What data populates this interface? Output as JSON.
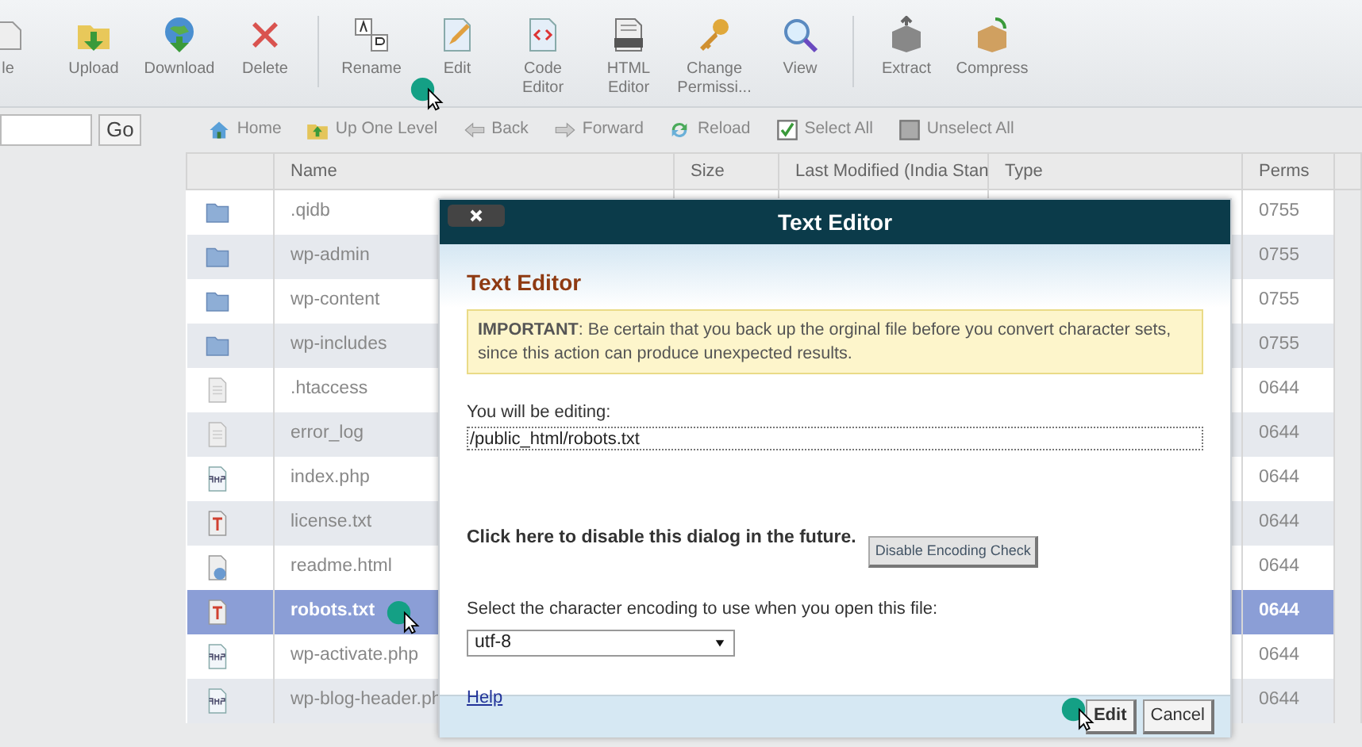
{
  "toolbar": [
    {
      "label": "le",
      "kind": "file"
    },
    {
      "label": "Upload",
      "kind": "upload"
    },
    {
      "label": "Download",
      "kind": "download"
    },
    {
      "label": "Delete",
      "kind": "delete"
    },
    {
      "kind": "separator"
    },
    {
      "label": "Rename",
      "kind": "rename"
    },
    {
      "label": "Edit",
      "kind": "edit"
    },
    {
      "label": "Code Editor",
      "kind": "code"
    },
    {
      "label": "HTML Editor",
      "kind": "html"
    },
    {
      "label": "Change Permissi...",
      "kind": "key"
    },
    {
      "label": "View",
      "kind": "view"
    },
    {
      "kind": "separator"
    },
    {
      "label": "Extract",
      "kind": "extract"
    },
    {
      "label": "Compress",
      "kind": "compress"
    }
  ],
  "search": {
    "button": "Go"
  },
  "nav": [
    {
      "label": "Home",
      "kind": "home"
    },
    {
      "label": "Up One Level",
      "kind": "up"
    },
    {
      "label": "Back",
      "kind": "back"
    },
    {
      "label": "Forward",
      "kind": "forward"
    },
    {
      "label": "Reload",
      "kind": "reload"
    },
    {
      "label": "Select All",
      "kind": "select"
    },
    {
      "label": "Unselect All",
      "kind": "unselect"
    }
  ],
  "table": {
    "columns": [
      "Name",
      "Size",
      "Last Modified (India Stan",
      "Type",
      "Perms"
    ],
    "rows": [
      {
        "name": ".qidb",
        "kind": "folder",
        "perms": "0755",
        "selected": false
      },
      {
        "name": "wp-admin",
        "kind": "folder",
        "perms": "0755",
        "selected": false
      },
      {
        "name": "wp-content",
        "kind": "folder",
        "perms": "0755",
        "selected": false
      },
      {
        "name": "wp-includes",
        "kind": "folder",
        "perms": "0755",
        "selected": false
      },
      {
        "name": ".htaccess",
        "kind": "doc",
        "perms": "0644",
        "selected": false
      },
      {
        "name": "error_log",
        "kind": "doc",
        "perms": "0644",
        "selected": false
      },
      {
        "name": "index.php",
        "kind": "php",
        "perms": "0644",
        "selected": false
      },
      {
        "name": "license.txt",
        "kind": "txt",
        "perms": "0644",
        "selected": false
      },
      {
        "name": "readme.html",
        "kind": "html",
        "perms": "0644",
        "selected": false
      },
      {
        "name": "robots.txt",
        "kind": "txt",
        "perms": "0644",
        "selected": true
      },
      {
        "name": "wp-activate.php",
        "kind": "php",
        "perms": "0644",
        "selected": false
      },
      {
        "name": "wp-blog-header.ph",
        "kind": "php",
        "perms": "0644",
        "selected": false
      }
    ]
  },
  "dialog": {
    "title": "Text Editor",
    "heading": "Text Editor",
    "warning": "**IMPORTANT**: Be certain that you back up the orginal file before you convert character sets, since this action can produce unexpected results.",
    "editing_label": "You will be editing:",
    "path": "/public_html/robots.txt",
    "disable_text": "Click here to disable this dialog in the future.",
    "disable_button": "Disable Encoding Check",
    "encoding_label": "Select the character encoding to use when you open this file:",
    "encoding": "utf-8",
    "help": "Help",
    "buttons": [
      "Edit",
      "Cancel"
    ]
  }
}
